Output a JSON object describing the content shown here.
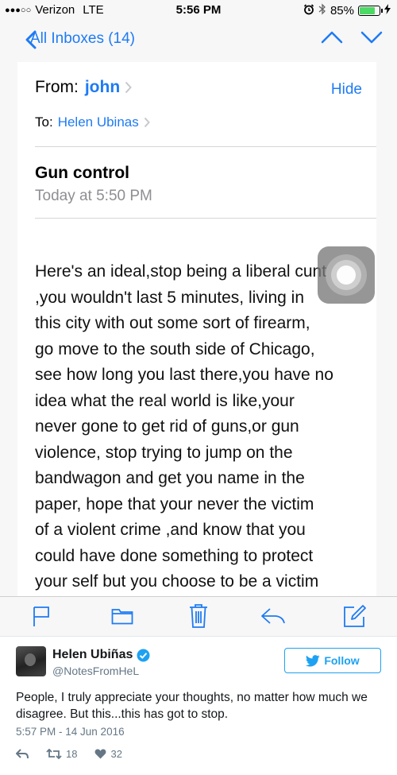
{
  "status_bar": {
    "signal": "●●●○○",
    "carrier": "Verizon",
    "network": "LTE",
    "time": "5:56 PM",
    "battery": "85%",
    "battery_level": 0.85
  },
  "nav": {
    "back_label": "All Inboxes (14)"
  },
  "mail": {
    "from_label": "From:",
    "from_name": "john",
    "hide_label": "Hide",
    "to_label": "To:",
    "to_name": "Helen Ubinas",
    "subject": "Gun control",
    "date": "Today at 5:50 PM",
    "body": "Here's an ideal,stop being a liberal  cunt\n,you wouldn't  last 5 minutes, living in\nthis city with out  some sort of firearm,\ngo move to the south side of Chicago,\nsee how long you last  there,you have no\nidea what the real world is like,your\nnever gone to get rid of guns,or gun\nviolence, stop trying  to jump on the\nbandwagon and get you name in the\npaper,  hope that your never the victim\nof a violent crime ,and know that you\ncould have done something to protect\nyour self but you choose  to be a victim"
  },
  "toolbar": {
    "icons": [
      "flag-icon",
      "folder-icon",
      "trash-icon",
      "reply-icon",
      "compose-icon"
    ]
  },
  "tweet": {
    "name": "Helen Ubiñas",
    "handle": "@NotesFromHeL",
    "follow_label": "Follow",
    "text": "People, I truly appreciate your thoughts, no matter how much we disagree. But this...this has got to stop.",
    "timestamp": "5:57 PM - 14 Jun 2016",
    "retweets": "18",
    "likes": "32"
  },
  "colors": {
    "ios_blue": "#1e7bf4",
    "twitter_blue": "#1da1f2",
    "battery_green": "#4cd964"
  }
}
